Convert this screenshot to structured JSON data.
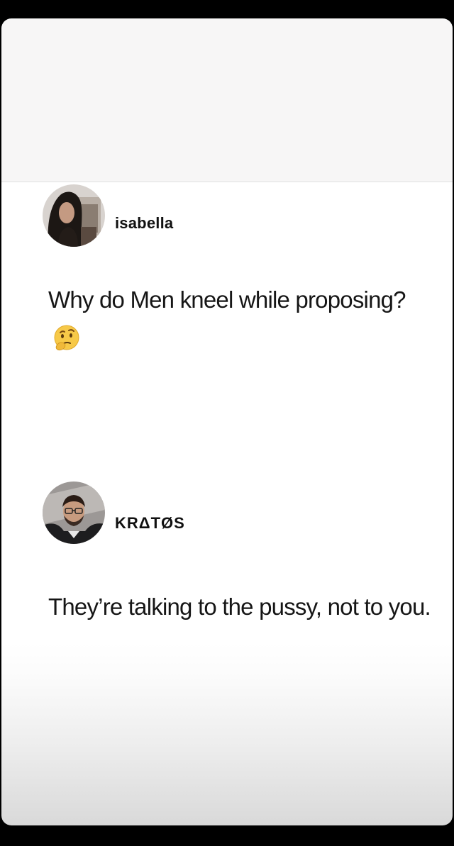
{
  "posts": [
    {
      "username": "isabella",
      "text": "Why do Men kneel while proposing?",
      "emoji": "thinking-face-icon"
    },
    {
      "username": "KRΔTØS",
      "text": "They’re talking to the pussy, not to you."
    }
  ],
  "colors": {
    "background": "#000000",
    "card": "#ffffff",
    "header_area": "#f7f6f6",
    "text": "#161616"
  }
}
